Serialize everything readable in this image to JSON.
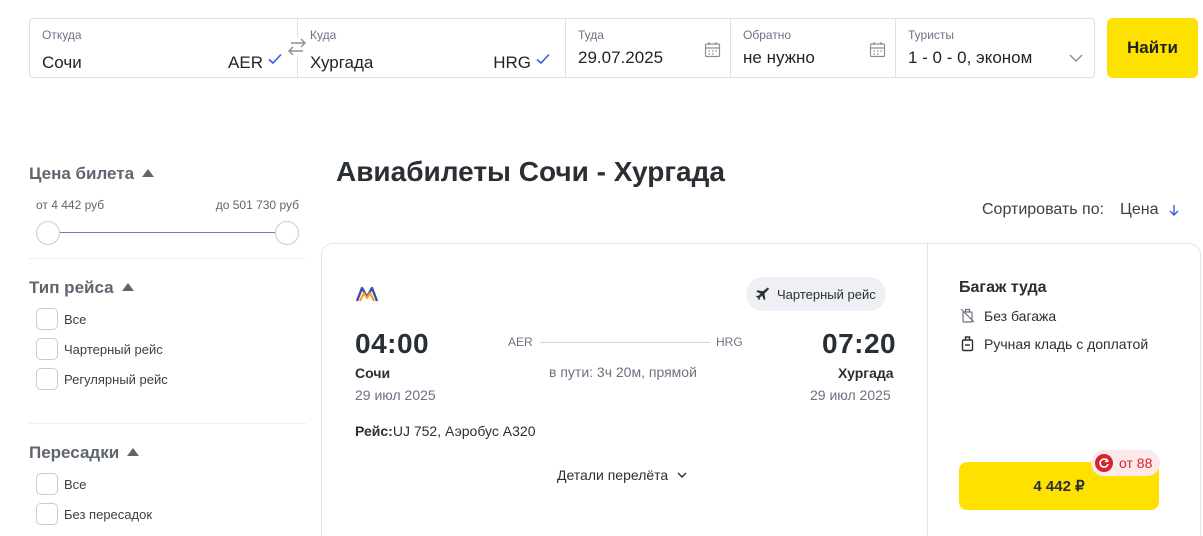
{
  "search": {
    "from": {
      "label": "Откуда",
      "city": "Сочи",
      "code": "AER"
    },
    "to": {
      "label": "Куда",
      "city": "Хургада",
      "code": "HRG"
    },
    "there": {
      "label": "Туда",
      "value": "29.07.2025"
    },
    "back": {
      "label": "Обратно",
      "value": "не нужно"
    },
    "tourists": {
      "label": "Туристы",
      "value": "1 - 0 - 0, эконом"
    },
    "find_label": "Найти"
  },
  "filters": {
    "price": {
      "title": "Цена билета",
      "from": "от 4 442 руб",
      "to": "до 501 730 руб"
    },
    "flight_type": {
      "title": "Тип рейса",
      "options": [
        "Все",
        "Чартерный рейс",
        "Регулярный рейс"
      ]
    },
    "transfers": {
      "title": "Пересадки",
      "options": [
        "Все",
        "Без пересадок"
      ]
    }
  },
  "main": {
    "title": "Авиабилеты Сочи - Хургада",
    "sort_label": "Сортировать по:",
    "sort_value": "Цена"
  },
  "flight": {
    "badge": "Чартерный рейс",
    "depart_time": "04:00",
    "arrive_time": "07:20",
    "depart_code": "AER",
    "arrive_code": "HRG",
    "duration": "в пути: 3ч 20м, прямой",
    "depart_city": "Сочи",
    "arrive_city": "Хургада",
    "depart_date": "29 июл 2025",
    "arrive_date": "29 июл 2025",
    "flight_label": "Рейс:",
    "flight_value": "UJ 752, Аэробус А320",
    "details_label": "Детали перелёта",
    "baggage_title": "Багаж туда",
    "baggage_none": "Без багажа",
    "hand_luggage": "Ручная кладь с доплатой",
    "price": "4 442 ₽",
    "bonus": "от 88"
  },
  "colors": {
    "accent_yellow": "#ffe100",
    "slider_blue": "#6979d9",
    "bonus_red": "#d6252f"
  }
}
